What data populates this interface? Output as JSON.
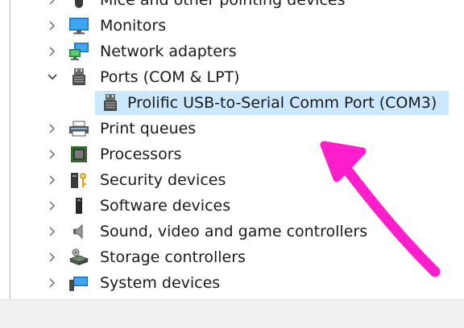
{
  "device_tree": {
    "items": [
      {
        "label": "Mice and other pointing devices",
        "icon": "mouse-icon",
        "expanded": false
      },
      {
        "label": "Monitors",
        "icon": "monitor-icon",
        "expanded": false
      },
      {
        "label": "Network adapters",
        "icon": "network-adapter-icon",
        "expanded": false
      },
      {
        "label": "Ports (COM & LPT)",
        "icon": "port-icon",
        "expanded": true,
        "children": [
          {
            "label": "Prolific USB-to-Serial Comm Port (COM3)",
            "icon": "port-icon",
            "selected": true
          }
        ]
      },
      {
        "label": "Print queues",
        "icon": "printer-icon",
        "expanded": false
      },
      {
        "label": "Processors",
        "icon": "processor-icon",
        "expanded": false
      },
      {
        "label": "Security devices",
        "icon": "security-device-icon",
        "expanded": false
      },
      {
        "label": "Software devices",
        "icon": "software-device-icon",
        "expanded": false
      },
      {
        "label": "Sound, video and game controllers",
        "icon": "speaker-icon",
        "expanded": false
      },
      {
        "label": "Storage controllers",
        "icon": "storage-controller-icon",
        "expanded": false
      },
      {
        "label": "System devices",
        "icon": "system-devices-icon",
        "expanded": false
      }
    ]
  },
  "colors": {
    "selection": "#cce8ff",
    "annotation_arrow": "#ff1ecb"
  }
}
